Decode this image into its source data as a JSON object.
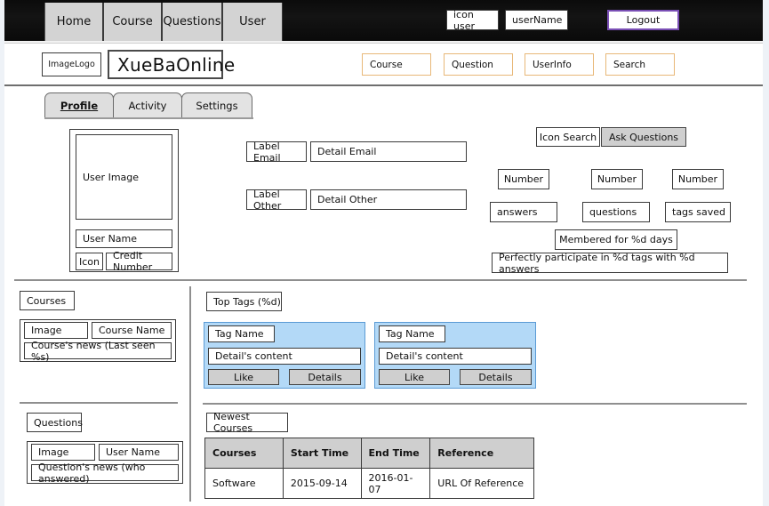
{
  "topbar": {
    "nav_items": [
      {
        "label": "Home",
        "name": "nav-home"
      },
      {
        "label": "Course",
        "name": "nav-course"
      },
      {
        "label": "Questions",
        "name": "nav-questions"
      },
      {
        "label": "User",
        "name": "nav-user"
      }
    ],
    "user_icon_label": "icon user",
    "user_name": "userName",
    "logout_label": "Logout",
    "logout_border_color": "#7a4fb5"
  },
  "logorow": {
    "image_logo": "ImageLogo",
    "site_title": "XueBaOnline",
    "buttons": [
      {
        "label": "Course",
        "name": "quicknav-course"
      },
      {
        "label": "Question",
        "name": "quicknav-question"
      },
      {
        "label": "UserInfo",
        "name": "quicknav-userinfo"
      },
      {
        "label": "Search",
        "name": "quicknav-search"
      }
    ],
    "button_border_color": "#e8b878"
  },
  "tabs": [
    {
      "label": "Profile",
      "active": true
    },
    {
      "label": "Activity",
      "active": false
    },
    {
      "label": "Settings",
      "active": false
    }
  ],
  "profile": {
    "user_image": "User Image",
    "user_name": "User Name",
    "icon": "Icon",
    "credit_number": "Credit Number",
    "label_email": "Label Email",
    "detail_email": "Detail Email",
    "label_other": "Label Other",
    "detail_other": "Detail Other"
  },
  "stats": {
    "icon_search": "Icon Search",
    "ask_questions": "Ask Questions",
    "numbers": [
      "Number",
      "Number",
      "Number"
    ],
    "captions": [
      "answers",
      "questions",
      "tags saved"
    ],
    "membered": "Membered for %d days",
    "participate": "Perfectly participate in %d tags with %d answers"
  },
  "courses_panel": {
    "title": "Courses",
    "image": "Image",
    "course_name": "Course Name",
    "news": "Course's news (Last seen %s)"
  },
  "questions_panel": {
    "title": "Questions",
    "image": "Image",
    "user_name": "User Name",
    "news": "Question's news (who answered)"
  },
  "top_tags": {
    "title": "Top Tags (%d)",
    "panel_bg": "#b3d9f7",
    "panel_border": "#5b9bd5",
    "cards": [
      {
        "tag_name": "Tag Name",
        "detail": "Detail's content",
        "like": "Like",
        "details": "Details"
      },
      {
        "tag_name": "Tag Name",
        "detail": "Detail's content",
        "like": "Like",
        "details": "Details"
      }
    ]
  },
  "newest_courses": {
    "title": "Newest Courses",
    "columns": [
      "Courses",
      "Start Time",
      "End Time",
      "Reference"
    ],
    "rows": [
      [
        "Software",
        "2015-09-14",
        "2016-01-07",
        "URL Of Reference"
      ]
    ]
  }
}
